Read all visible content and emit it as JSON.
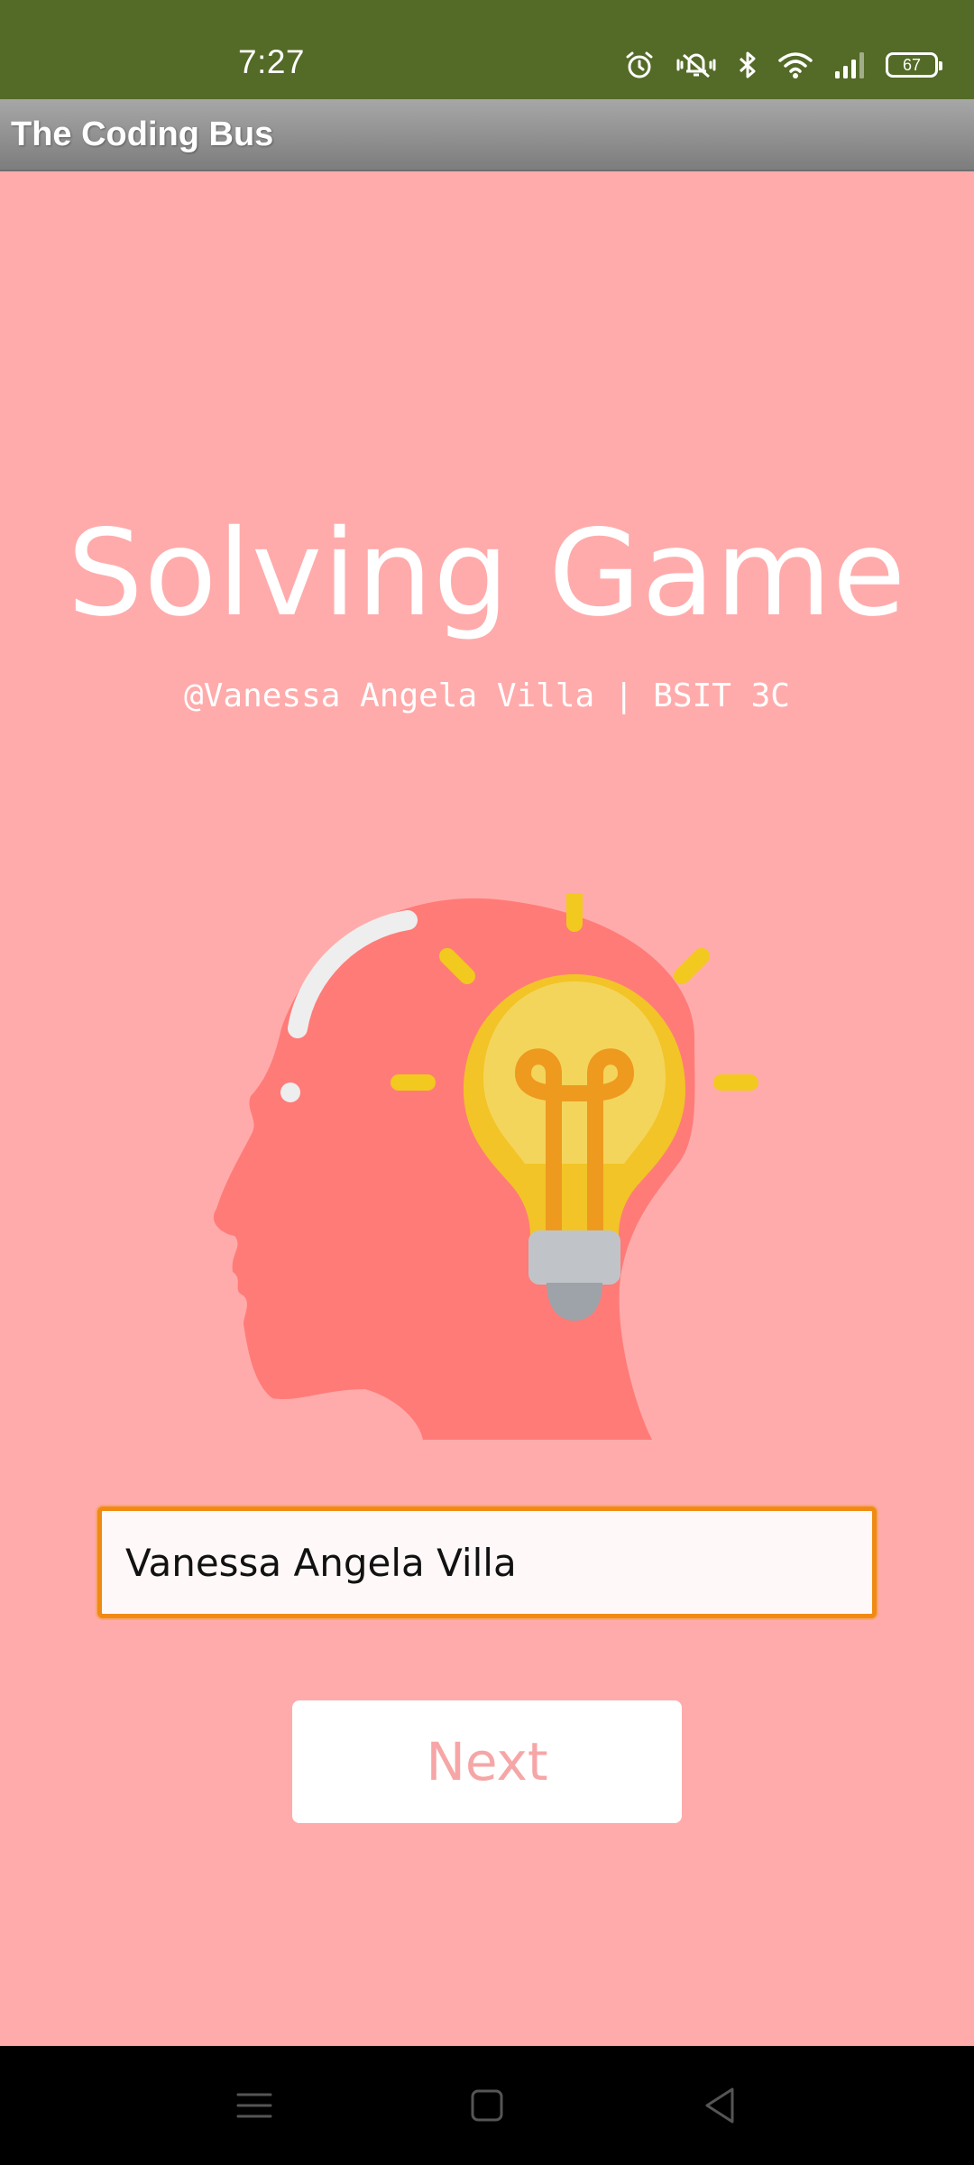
{
  "status_bar": {
    "time": "7:27",
    "battery_level": "67",
    "icons": [
      "alarm-icon",
      "vibrate-mute-icon",
      "bluetooth-icon",
      "wifi-icon",
      "signal-icon",
      "battery-icon"
    ],
    "background_color": "#546A27"
  },
  "app_bar": {
    "title": "The Coding Bus"
  },
  "main": {
    "title": "Solving Game",
    "subtitle": "@Vanessa Angela Villa | BSIT 3C",
    "illustration": "head-with-lightbulb-illustration",
    "name_input": {
      "value": "Vanessa Angela Villa"
    },
    "next_button_label": "Next",
    "background_color": "#FFABAB"
  },
  "nav_bar": {
    "buttons": [
      "menu-icon",
      "home-icon",
      "back-icon"
    ]
  }
}
